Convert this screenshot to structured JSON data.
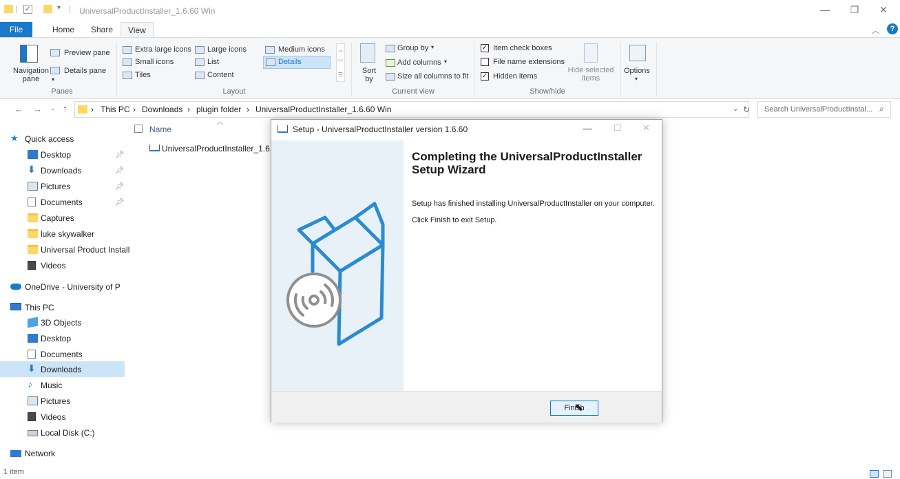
{
  "window": {
    "title": "UniversalProductInstaller_1.6.60 Win",
    "minimize": "—",
    "restore": "❐",
    "close": "✕"
  },
  "tabs": [
    "File",
    "Home",
    "Share",
    "View"
  ],
  "ribbon": {
    "panes": {
      "navigation_pane": "Navigation pane",
      "preview_pane": "Preview pane",
      "details_pane": "Details pane",
      "group_label": "Panes"
    },
    "layout": {
      "extra_large_icons": "Extra large icons",
      "large_icons": "Large icons",
      "medium_icons": "Medium icons",
      "small_icons": "Small icons",
      "list": "List",
      "details": "Details",
      "tiles": "Tiles",
      "content": "Content",
      "group_label": "Layout"
    },
    "current_view": {
      "sort_by": "Sort by",
      "group_by": "Group by",
      "add_columns": "Add columns",
      "size_all_columns": "Size all columns to fit",
      "group_label": "Current view"
    },
    "show_hide": {
      "item_check_boxes": "Item check boxes",
      "file_name_extensions": "File name extensions",
      "hidden_items": "Hidden items",
      "hide_selected_items": "Hide selected items",
      "group_label": "Show/hide"
    },
    "options": "Options"
  },
  "address": {
    "crumbs": [
      "This PC",
      "Downloads",
      "plugin folder",
      "UniversalProductInstaller_1.6.60 Win"
    ],
    "search_placeholder": "Search UniversalProductInstal..."
  },
  "nav": {
    "quick_access": "Quick access",
    "quick_items": [
      "Desktop",
      "Downloads",
      "Pictures",
      "Documents",
      "Captures",
      "luke skywalker",
      "Universal Product Install",
      "Videos"
    ],
    "onedrive": "OneDrive - University of P",
    "this_pc": "This PC",
    "pc_items": [
      "3D Objects",
      "Desktop",
      "Documents",
      "Downloads",
      "Music",
      "Pictures",
      "Videos",
      "Local Disk (C:)"
    ],
    "network": "Network"
  },
  "file_list": {
    "column_name": "Name",
    "items": [
      "UniversalProductInstaller_1.6.60"
    ]
  },
  "dialog": {
    "title": "Setup - UniversalProductInstaller version 1.6.60",
    "heading": "Completing the UniversalProductInstaller Setup Wizard",
    "message1": "Setup has finished installing UniversalProductInstaller on your computer.",
    "message2": "Click Finish to exit Setup.",
    "finish_button": "Finish"
  },
  "status": "1 item",
  "colors": {
    "accent": "#1979ca",
    "selection": "#cce4f7",
    "installer_blue": "#2a8bd1"
  }
}
